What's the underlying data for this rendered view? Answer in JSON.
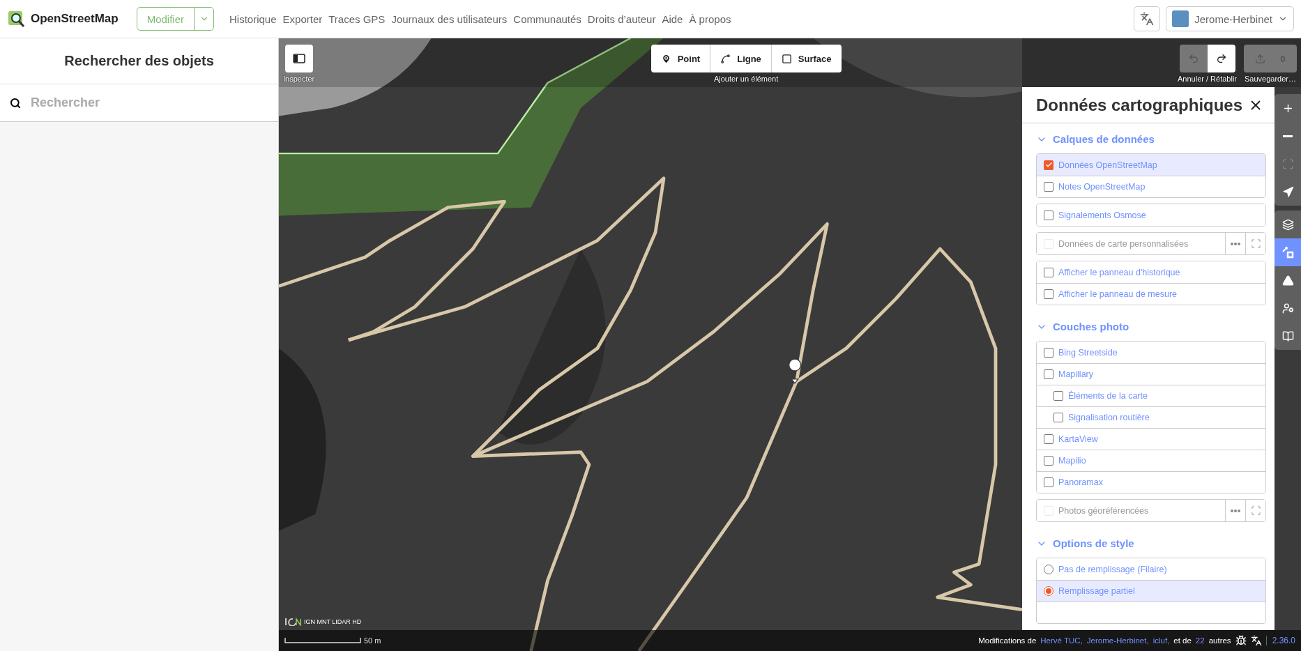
{
  "header": {
    "logo": "OpenStreetMap",
    "edit_button": "Modifier",
    "nav": [
      "Historique",
      "Exporter",
      "Traces GPS",
      "Journaux des utilisateurs",
      "Communautés",
      "Droits d’auteur",
      "Aide",
      "À propos"
    ],
    "user": "Jerome-Herbinet"
  },
  "sidebar": {
    "title": "Rechercher des objets",
    "search": {
      "placeholder": "Rechercher"
    }
  },
  "map_toolbar": {
    "inspect_label": "Inspecter",
    "add_buttons": [
      {
        "kind": "point",
        "label": "Point"
      },
      {
        "kind": "line",
        "label": "Ligne"
      },
      {
        "kind": "area",
        "label": "Surface"
      }
    ],
    "add_label": "Ajouter un élément",
    "undo": {
      "disabled": true
    },
    "redo": {
      "disabled": false
    },
    "undo_label": "Annuler / Rétablir",
    "save": {
      "count": "0",
      "disabled": true
    },
    "save_label": "Sauvegarder…"
  },
  "panel": {
    "title": "Données cartographiques",
    "sections": [
      {
        "title": "Calques de données",
        "expanded": true,
        "groups": [
          [
            {
              "kind": "checkbox",
              "label": "Données OpenStreetMap",
              "checked": true,
              "disabled": false
            },
            {
              "kind": "checkbox",
              "label": "Notes OpenStreetMap",
              "checked": false,
              "disabled": false
            }
          ],
          [
            {
              "kind": "checkbox",
              "label": "Signalements Osmose",
              "checked": false,
              "disabled": false
            }
          ],
          [
            {
              "kind": "tools",
              "label": "Données de carte personnalisées",
              "checked": false,
              "disabled": true
            }
          ],
          [
            {
              "kind": "checkbox",
              "label": "Afficher le panneau d'historique",
              "checked": false,
              "disabled": false
            },
            {
              "kind": "checkbox",
              "label": "Afficher le panneau de mesure",
              "checked": false,
              "disabled": false
            }
          ]
        ]
      },
      {
        "title": "Couches photo",
        "expanded": true,
        "groups": [
          [
            {
              "kind": "checkbox",
              "label": "Bing Streetside",
              "checked": false,
              "disabled": false
            },
            {
              "kind": "checkbox",
              "label": "Mapillary",
              "checked": false,
              "disabled": false,
              "children": [
                {
                  "kind": "checkbox",
                  "label": "Éléments de la carte",
                  "checked": false,
                  "disabled": false
                },
                {
                  "kind": "checkbox",
                  "label": "Signalisation routière",
                  "checked": false,
                  "disabled": false
                }
              ]
            },
            {
              "kind": "checkbox",
              "label": "KartaView",
              "checked": false,
              "disabled": false
            },
            {
              "kind": "checkbox",
              "label": "Mapilio",
              "checked": false,
              "disabled": false
            },
            {
              "kind": "checkbox",
              "label": "Panoramax",
              "checked": false,
              "disabled": false
            }
          ],
          [
            {
              "kind": "tools",
              "label": "Photos géoréférencées",
              "checked": false,
              "disabled": true
            }
          ]
        ]
      },
      {
        "title": "Options de style",
        "expanded": true,
        "groups": [
          [
            {
              "kind": "radio",
              "label": "Pas de remplissage (Filaire)",
              "checked": false,
              "disabled": false
            },
            {
              "kind": "radio",
              "label": "Remplissage partiel",
              "checked": true,
              "disabled": false
            },
            {
              "kind": "blank"
            }
          ]
        ]
      }
    ]
  },
  "map_controls": [
    [
      {
        "kind": "zoom-in",
        "selected": false,
        "disabled": false
      },
      {
        "kind": "zoom-out",
        "selected": false,
        "disabled": false
      },
      {
        "kind": "zoom-selection",
        "selected": false,
        "disabled": true
      },
      {
        "kind": "geolocate",
        "selected": false,
        "disabled": false
      }
    ],
    [
      {
        "kind": "background",
        "selected": false,
        "disabled": false
      },
      {
        "kind": "map-data",
        "selected": true,
        "disabled": false
      },
      {
        "kind": "issues",
        "selected": false,
        "disabled": false
      },
      {
        "kind": "preferences",
        "selected": false,
        "disabled": false
      },
      {
        "kind": "help",
        "selected": false,
        "disabled": false
      }
    ]
  ],
  "attribution": "IGN MNT LIDAR HD",
  "scale": "50 m",
  "footer": {
    "prefix": "Modifications de",
    "users": [
      "Hervé TUC,",
      "Jerome-Herbinet,",
      "icluf,"
    ],
    "middle": "et de",
    "count": "22",
    "suffix": "autres",
    "version": "2.36.0"
  }
}
